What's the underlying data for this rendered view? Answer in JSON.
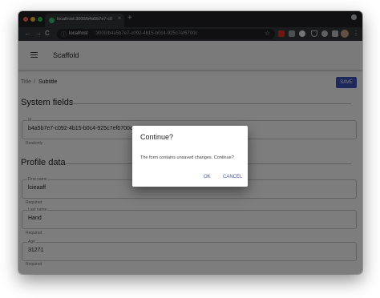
{
  "browser": {
    "tab_title": "localhost:3000/b4a5b7e7-c0",
    "tab_close": "×",
    "new_tab": "+",
    "nav_back": "←",
    "nav_forward": "→",
    "nav_reload": "C",
    "address_info_icon": "ⓘ",
    "address_host": "localhost",
    "address_path": ":3000/b4a5b7e7-c092-4b15-b0c4-925c7ef6700c",
    "bookmark_star": "☆",
    "menu_dots": "⋮",
    "colors": {
      "tabbar": "#202124",
      "toolbar": "#35363a",
      "omnibox": "#202124"
    }
  },
  "app": {
    "title": "Scaffold",
    "breadcrumb": {
      "item1": "Title",
      "separator": "/",
      "item2": "Subtitle"
    },
    "save_label": "SAVE",
    "accent_color": "#3f51b5"
  },
  "system_fields": {
    "heading": "System fields",
    "id_field": {
      "label": "Id",
      "value": "b4a5b7e7-c092-4b15-b0c4-925c7ef6700c",
      "helper": "Readonly"
    }
  },
  "profile_data": {
    "heading": "Profile data",
    "first_name": {
      "label": "First name",
      "value": "lcieaaff",
      "helper": "Required"
    },
    "last_name": {
      "label": "Last name",
      "value": "Hand",
      "helper": "Required"
    },
    "age": {
      "label": "Age",
      "value": "31271",
      "helper": "Required"
    }
  },
  "dialog": {
    "title": "Continue?",
    "message": "The form contains unsaved changes. Continue?",
    "ok_label": "OK",
    "cancel_label": "CANCEL"
  }
}
